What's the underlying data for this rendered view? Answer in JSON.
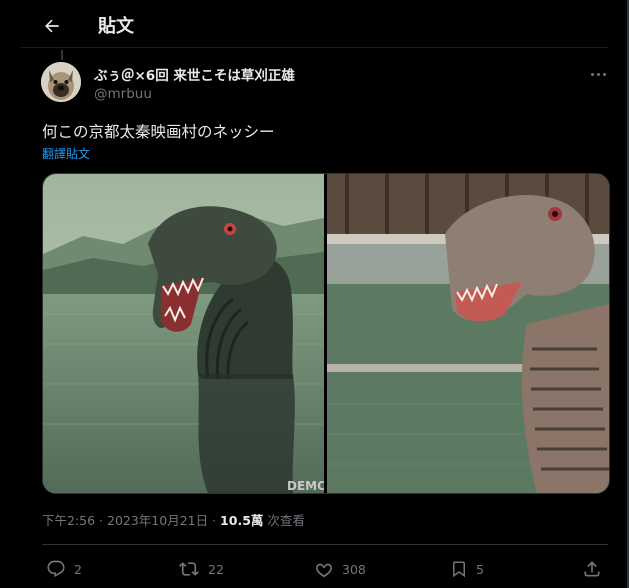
{
  "header": {
    "title": "貼文"
  },
  "author": {
    "display_name": "ぶぅ＠×6回 来世こそは草刈正雄",
    "handle": "@mrbuu"
  },
  "tweet": {
    "text": "何この京都太秦映画村のネッシー",
    "translate_label": "翻譯貼文"
  },
  "media": {
    "watermark": "DEMO"
  },
  "meta": {
    "time": "下午2:56",
    "separator": " · ",
    "date": "2023年10月21日",
    "views_count": "10.5萬",
    "views_label": " 次查看"
  },
  "actions": {
    "replies": "2",
    "retweets": "22",
    "likes": "308",
    "bookmarks": "5"
  },
  "colors": {
    "background": "#000000",
    "text_primary": "#e7e9ea",
    "text_secondary": "#71767b",
    "link": "#1d9bf0",
    "border": "#2f3336"
  }
}
